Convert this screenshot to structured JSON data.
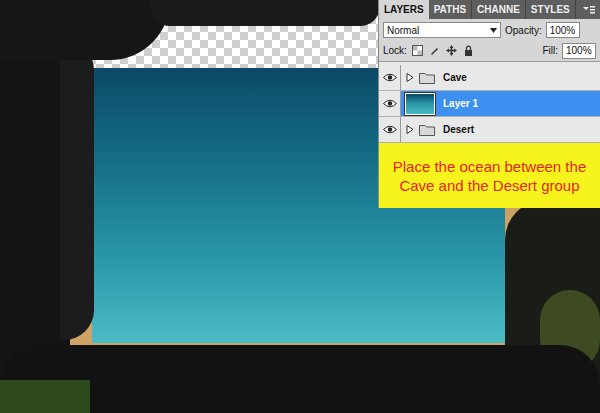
{
  "panel": {
    "tabs": [
      {
        "label": "LAYERS",
        "selected": true
      },
      {
        "label": "PATHS",
        "selected": false
      },
      {
        "label": "CHANNE",
        "selected": false
      },
      {
        "label": "STYLES",
        "selected": false
      }
    ],
    "blend_mode": "Normal",
    "opacity_label": "Opacity:",
    "opacity": "100%",
    "lock_label": "Lock:",
    "fill_label": "Fill:",
    "fill": "100%",
    "layers": [
      {
        "name": "Cave",
        "kind": "group",
        "visible": true,
        "selected": false
      },
      {
        "name": "Layer 1",
        "kind": "layer",
        "visible": true,
        "selected": true
      },
      {
        "name": "Desert",
        "kind": "group",
        "visible": true,
        "selected": false
      }
    ]
  },
  "callout": {
    "text": "Place the ocean between the Cave and the Desert group"
  }
}
